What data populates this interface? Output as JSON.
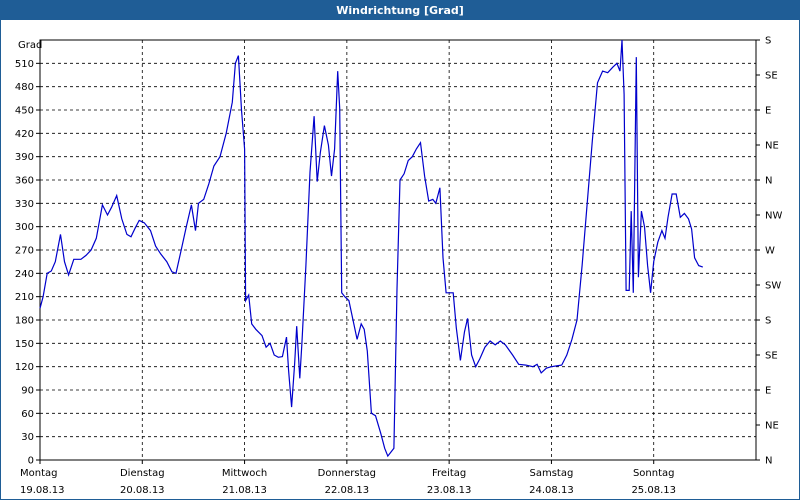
{
  "window": {
    "title": "Windrichtung [Grad]"
  },
  "colors": {
    "title_bar": "#1f5d96",
    "line": "#0000cc",
    "grid": "#000000"
  },
  "chart_data": {
    "type": "line",
    "title": "Windrichtung [Grad]",
    "ylabel": "Grad",
    "ylim": [
      0,
      540
    ],
    "yticks": [
      0,
      30,
      60,
      90,
      120,
      150,
      180,
      210,
      240,
      270,
      300,
      330,
      360,
      390,
      420,
      450,
      480,
      510
    ],
    "right_axis_labels": [
      "N",
      "NE",
      "E",
      "SE",
      "S",
      "SW",
      "W",
      "NW",
      "N",
      "NE",
      "E",
      "SE",
      "S"
    ],
    "right_axis_values": [
      0,
      45,
      90,
      135,
      180,
      225,
      270,
      315,
      360,
      405,
      450,
      495,
      540
    ],
    "xlim": [
      0,
      7
    ],
    "x_labels": [
      {
        "day": "Montag",
        "date": "19.08.13"
      },
      {
        "day": "Dienstag",
        "date": "20.08.13"
      },
      {
        "day": "Mittwoch",
        "date": "21.08.13"
      },
      {
        "day": "Donnerstag",
        "date": "22.08.13"
      },
      {
        "day": "Freitag",
        "date": "23.08.13"
      },
      {
        "day": "Samstag",
        "date": "24.08.13"
      },
      {
        "day": "Sonntag",
        "date": "25.08.13"
      }
    ],
    "grid": true,
    "series": [
      {
        "values": [
          [
            0.0,
            195
          ],
          [
            0.03,
            210
          ],
          [
            0.07,
            240
          ],
          [
            0.11,
            243
          ],
          [
            0.15,
            255
          ],
          [
            0.2,
            290
          ],
          [
            0.24,
            255
          ],
          [
            0.28,
            238
          ],
          [
            0.33,
            258
          ],
          [
            0.4,
            258
          ],
          [
            0.45,
            263
          ],
          [
            0.5,
            270
          ],
          [
            0.55,
            285
          ],
          [
            0.61,
            328
          ],
          [
            0.66,
            315
          ],
          [
            0.7,
            325
          ],
          [
            0.75,
            340
          ],
          [
            0.8,
            310
          ],
          [
            0.85,
            290
          ],
          [
            0.89,
            287
          ],
          [
            0.93,
            298
          ],
          [
            0.97,
            308
          ],
          [
            1.02,
            305
          ],
          [
            1.08,
            295
          ],
          [
            1.13,
            275
          ],
          [
            1.18,
            265
          ],
          [
            1.24,
            255
          ],
          [
            1.29,
            242
          ],
          [
            1.33,
            240
          ],
          [
            1.38,
            270
          ],
          [
            1.43,
            300
          ],
          [
            1.48,
            328
          ],
          [
            1.52,
            295
          ],
          [
            1.55,
            330
          ],
          [
            1.6,
            335
          ],
          [
            1.65,
            355
          ],
          [
            1.7,
            378
          ],
          [
            1.76,
            390
          ],
          [
            1.82,
            420
          ],
          [
            1.88,
            460
          ],
          [
            1.91,
            510
          ],
          [
            1.94,
            520
          ],
          [
            1.97,
            450
          ],
          [
            2.0,
            400
          ],
          [
            2.01,
            205
          ],
          [
            2.04,
            212
          ],
          [
            2.07,
            175
          ],
          [
            2.11,
            168
          ],
          [
            2.17,
            160
          ],
          [
            2.21,
            145
          ],
          [
            2.25,
            150
          ],
          [
            2.29,
            135
          ],
          [
            2.33,
            132
          ],
          [
            2.37,
            133
          ],
          [
            2.41,
            158
          ],
          [
            2.43,
            115
          ],
          [
            2.46,
            68
          ],
          [
            2.49,
            125
          ],
          [
            2.51,
            172
          ],
          [
            2.54,
            105
          ],
          [
            2.56,
            150
          ],
          [
            2.6,
            250
          ],
          [
            2.64,
            370
          ],
          [
            2.68,
            442
          ],
          [
            2.71,
            358
          ],
          [
            2.74,
            395
          ],
          [
            2.78,
            430
          ],
          [
            2.82,
            405
          ],
          [
            2.85,
            365
          ],
          [
            2.88,
            400
          ],
          [
            2.91,
            500
          ],
          [
            2.93,
            452
          ],
          [
            2.95,
            215
          ],
          [
            2.98,
            210
          ],
          [
            3.02,
            205
          ],
          [
            3.06,
            180
          ],
          [
            3.1,
            155
          ],
          [
            3.14,
            175
          ],
          [
            3.17,
            168
          ],
          [
            3.2,
            140
          ],
          [
            3.24,
            60
          ],
          [
            3.28,
            57
          ],
          [
            3.33,
            35
          ],
          [
            3.37,
            15
          ],
          [
            3.4,
            5
          ],
          [
            3.43,
            10
          ],
          [
            3.46,
            15
          ],
          [
            3.49,
            220
          ],
          [
            3.52,
            360
          ],
          [
            3.56,
            368
          ],
          [
            3.6,
            385
          ],
          [
            3.64,
            390
          ],
          [
            3.68,
            400
          ],
          [
            3.72,
            408
          ],
          [
            3.76,
            365
          ],
          [
            3.8,
            333
          ],
          [
            3.84,
            335
          ],
          [
            3.87,
            330
          ],
          [
            3.91,
            350
          ],
          [
            3.94,
            260
          ],
          [
            3.97,
            215
          ],
          [
            4.0,
            215
          ],
          [
            4.04,
            215
          ],
          [
            4.07,
            170
          ],
          [
            4.11,
            128
          ],
          [
            4.15,
            165
          ],
          [
            4.18,
            182
          ],
          [
            4.22,
            135
          ],
          [
            4.26,
            120
          ],
          [
            4.3,
            130
          ],
          [
            4.35,
            145
          ],
          [
            4.4,
            153
          ],
          [
            4.45,
            148
          ],
          [
            4.5,
            153
          ],
          [
            4.55,
            148
          ],
          [
            4.62,
            135
          ],
          [
            4.68,
            123
          ],
          [
            4.75,
            122
          ],
          [
            4.82,
            120
          ],
          [
            4.86,
            123
          ],
          [
            4.9,
            112
          ],
          [
            4.95,
            118
          ],
          [
            5.0,
            120
          ],
          [
            5.05,
            121
          ],
          [
            5.1,
            122
          ],
          [
            5.15,
            135
          ],
          [
            5.2,
            155
          ],
          [
            5.25,
            180
          ],
          [
            5.3,
            250
          ],
          [
            5.35,
            330
          ],
          [
            5.4,
            410
          ],
          [
            5.45,
            485
          ],
          [
            5.5,
            500
          ],
          [
            5.55,
            498
          ],
          [
            5.6,
            505
          ],
          [
            5.64,
            510
          ],
          [
            5.67,
            500
          ],
          [
            5.69,
            540
          ],
          [
            5.71,
            470
          ],
          [
            5.73,
            218
          ],
          [
            5.76,
            218
          ],
          [
            5.78,
            320
          ],
          [
            5.8,
            215
          ],
          [
            5.83,
            518
          ],
          [
            5.85,
            235
          ],
          [
            5.88,
            320
          ],
          [
            5.91,
            300
          ],
          [
            5.94,
            250
          ],
          [
            5.97,
            215
          ],
          [
            6.0,
            255
          ],
          [
            6.04,
            280
          ],
          [
            6.08,
            295
          ],
          [
            6.11,
            285
          ],
          [
            6.14,
            312
          ],
          [
            6.18,
            342
          ],
          [
            6.22,
            342
          ],
          [
            6.26,
            312
          ],
          [
            6.3,
            317
          ],
          [
            6.34,
            310
          ],
          [
            6.37,
            297
          ],
          [
            6.4,
            260
          ],
          [
            6.44,
            250
          ],
          [
            6.48,
            248
          ]
        ]
      }
    ]
  }
}
